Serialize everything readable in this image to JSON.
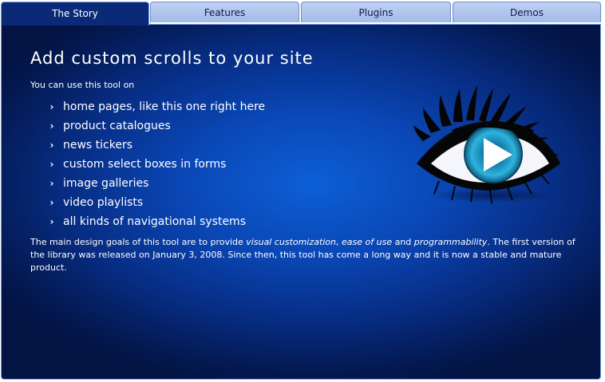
{
  "tabs": [
    {
      "label": "The Story",
      "active": true
    },
    {
      "label": "Features",
      "active": false
    },
    {
      "label": "Plugins",
      "active": false
    },
    {
      "label": "Demos",
      "active": false
    }
  ],
  "content": {
    "headline": "Add custom scrolls to your site",
    "intro": "You can use this tool on",
    "uses": [
      "home pages, like this one right here",
      "product catalogues",
      "news tickers",
      "custom select boxes in forms",
      "image galleries",
      "video playlists",
      "all kinds of navigational systems"
    ],
    "goals": {
      "part1": "The main design goals of this tool are to provide ",
      "em1": "visual customization",
      "sep1": ", ",
      "em2": "ease of use",
      "sep2": " and ",
      "em3": "programmability",
      "part2": ". The first version of the library was released on January 3, 2008. Since then, this tool has come a long way and it is now a stable and mature product."
    }
  },
  "icons": {
    "bullet": "chevron-right-icon",
    "logo": "eye-play-logo"
  },
  "colors": {
    "panel_center": "#0d5fd6",
    "panel_edge": "#031444",
    "tab_inactive": "#a3bbe9",
    "iris": "#1a8fc0"
  }
}
